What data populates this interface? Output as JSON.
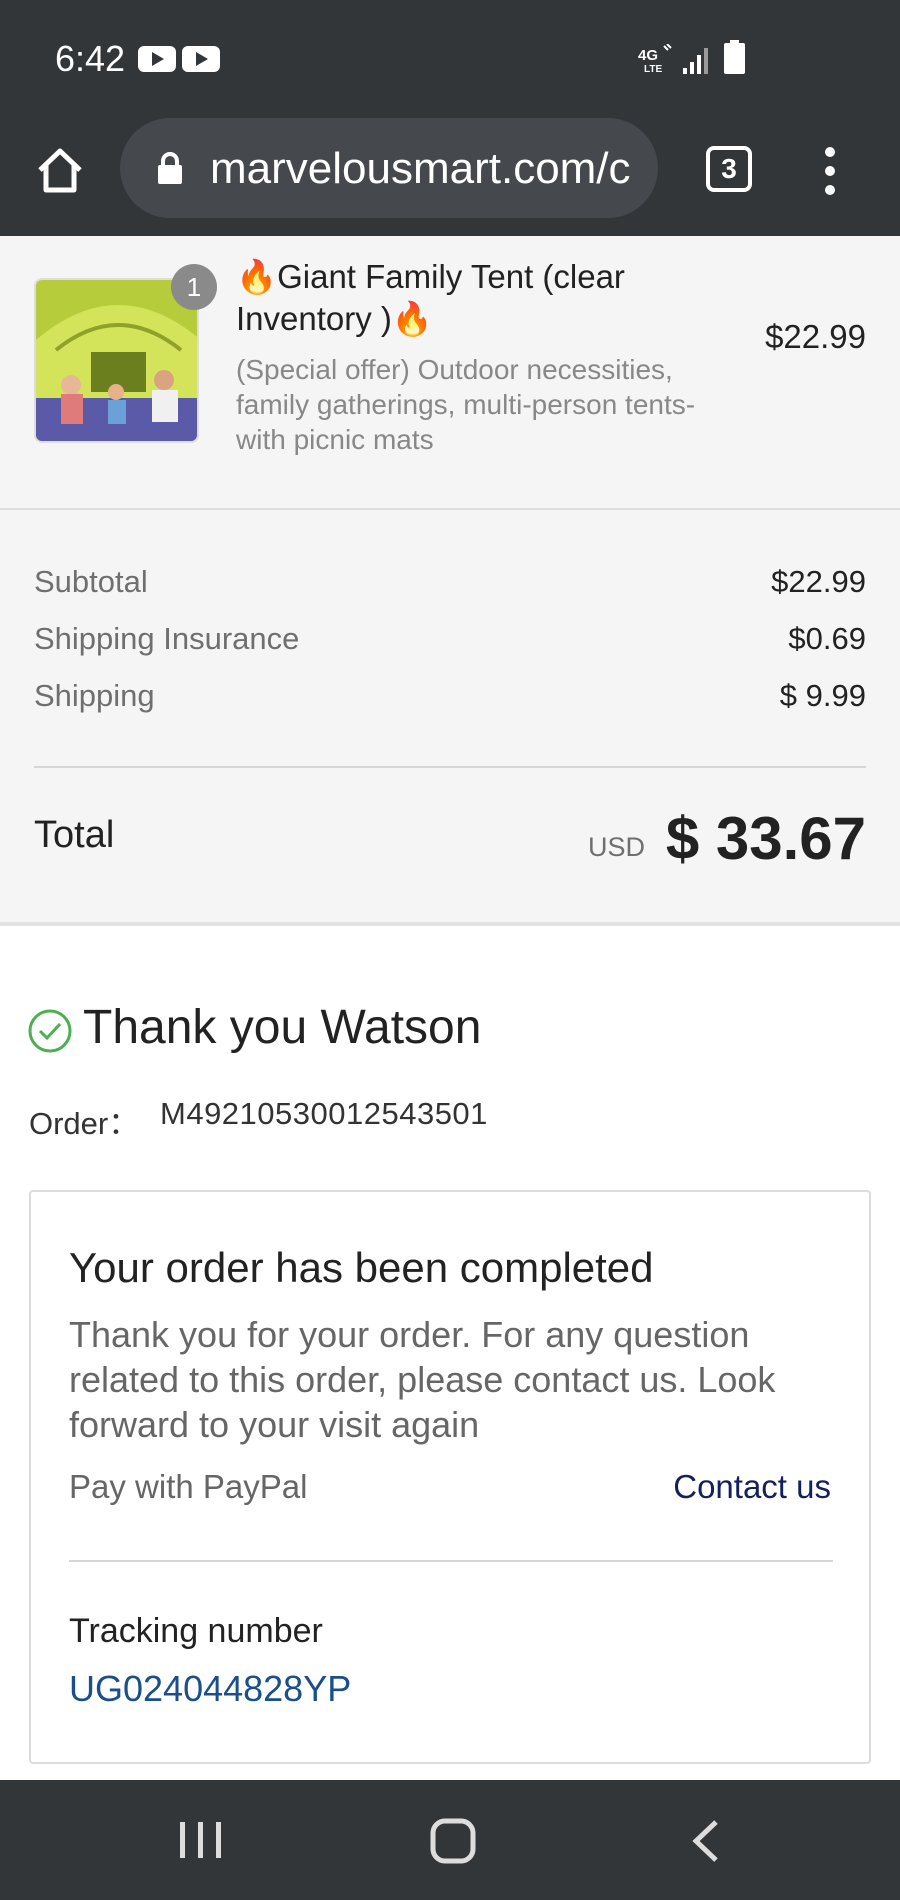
{
  "status_bar": {
    "time": "6:42",
    "icons": [
      "youtube-icon",
      "youtube-icon",
      "4g-lte-icon",
      "signal-icon",
      "battery-icon"
    ]
  },
  "browser": {
    "url": "marvelousmart.com/c",
    "tab_count": "3"
  },
  "product": {
    "quantity": "1",
    "title": "🔥Giant Family Tent (clear Inventory )🔥",
    "description": "(Special offer) Outdoor necessities, family gatherings, multi-person tents-with picnic mats",
    "price": "$22.99"
  },
  "costs": {
    "subtotal_label": "Subtotal",
    "subtotal_value": "$22.99",
    "insurance_label": "Shipping Insurance",
    "insurance_value": "$0.69",
    "shipping_label": "Shipping",
    "shipping_value": "$ 9.99",
    "total_label": "Total",
    "currency": "USD",
    "total_value": "$ 33.67"
  },
  "confirmation": {
    "thank_you": "Thank you Watson",
    "order_label": "Order：",
    "order_number": "M49210530012543501"
  },
  "card": {
    "heading": "Your order has been completed",
    "body": "Thank you for your order. For any question related to this order, please contact us. Look forward to your visit again",
    "pay_method": "Pay with PayPal",
    "contact_link": "Contact us",
    "tracking_label": "Tracking number",
    "tracking_number": "UG024044828YP"
  },
  "colors": {
    "chrome_dark": "#323639",
    "check_green": "#4caf50",
    "link_navy": "#14205c",
    "tracking_blue": "#1a4f8b"
  }
}
